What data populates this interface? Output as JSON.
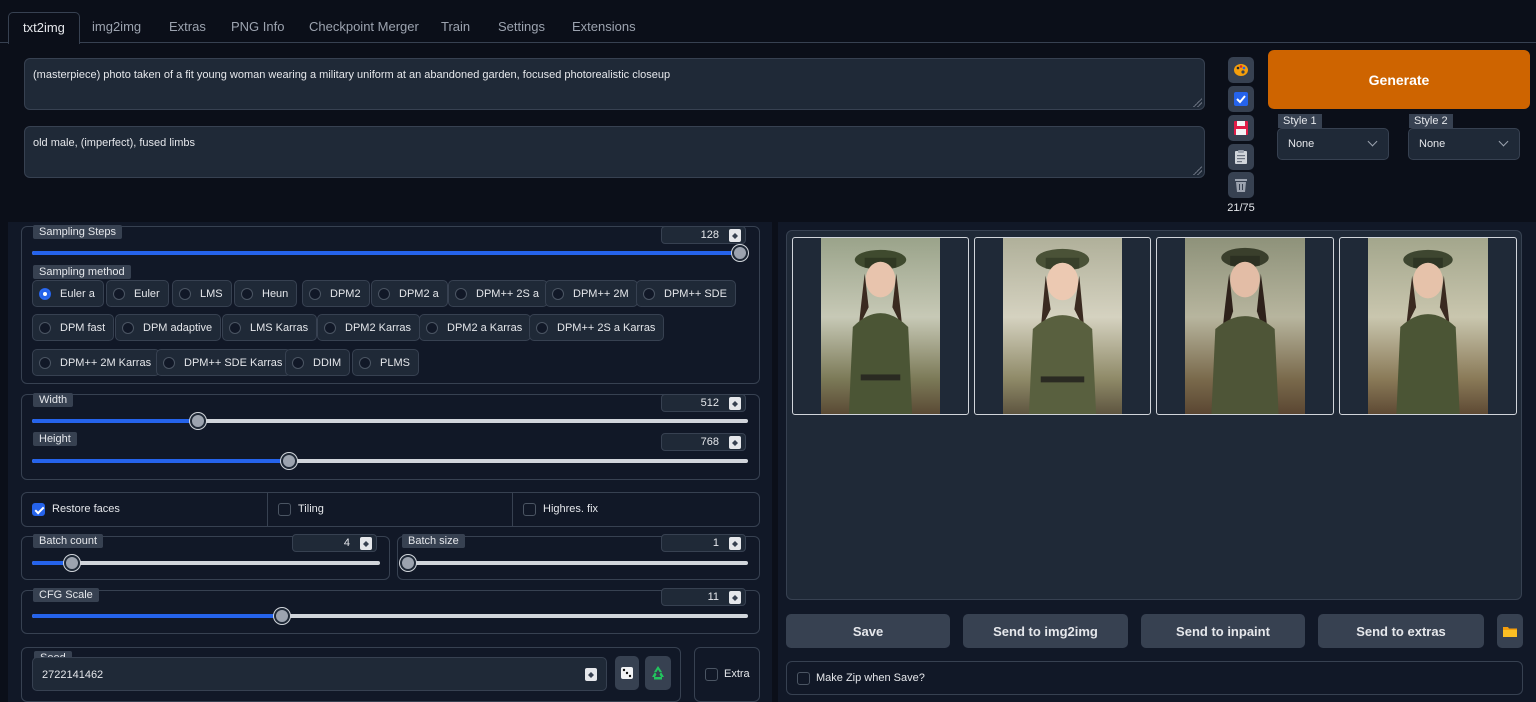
{
  "tabs": [
    "txt2img",
    "img2img",
    "Extras",
    "PNG Info",
    "Checkpoint Merger",
    "Train",
    "Settings",
    "Extensions"
  ],
  "prompt": "(masterpiece) photo taken of a fit young woman wearing a military uniform at an abandoned garden, focused photorealistic closeup",
  "negative_prompt": "old male, (imperfect), fused limbs",
  "token_counter": "21/75",
  "generate_label": "Generate",
  "styles": [
    {
      "label": "Style 1",
      "value": "None"
    },
    {
      "label": "Style 2",
      "value": "None"
    }
  ],
  "tool_icons": [
    "palette-icon",
    "checkbox-icon",
    "save-icon",
    "clipboard-icon",
    "trash-icon"
  ],
  "sampling_steps": {
    "label": "Sampling Steps",
    "value": "128",
    "fraction": 1.0
  },
  "sampling_method": {
    "label": "Sampling method",
    "selected": "Euler a",
    "options": [
      "Euler a",
      "Euler",
      "LMS",
      "Heun",
      "DPM2",
      "DPM2 a",
      "DPM++ 2S a",
      "DPM++ 2M",
      "DPM++ SDE",
      "DPM fast",
      "DPM adaptive",
      "LMS Karras",
      "DPM2 Karras",
      "DPM2 a Karras",
      "DPM++ 2S a Karras",
      "DPM++ 2M Karras",
      "DPM++ SDE Karras",
      "DDIM",
      "PLMS"
    ]
  },
  "width": {
    "label": "Width",
    "value": "512",
    "fraction": 0.23
  },
  "height": {
    "label": "Height",
    "value": "768",
    "fraction": 0.36
  },
  "restore_faces": {
    "label": "Restore faces",
    "checked": true
  },
  "tiling": {
    "label": "Tiling",
    "checked": false
  },
  "highres_fix": {
    "label": "Highres. fix",
    "checked": false
  },
  "batch_count": {
    "label": "Batch count",
    "value": "4",
    "fraction": 0.11
  },
  "batch_size": {
    "label": "Batch size",
    "value": "1",
    "fraction": 0.0
  },
  "cfg_scale": {
    "label": "CFG Scale",
    "value": "11",
    "fraction": 0.35
  },
  "seed": {
    "label": "Seed",
    "value": "2722141462"
  },
  "extra": {
    "label": "Extra",
    "checked": false
  },
  "output_buttons": [
    "Save",
    "Send to img2img",
    "Send to inpaint",
    "Send to extras"
  ],
  "make_zip": {
    "label": "Make Zip when Save?",
    "checked": false
  },
  "colors": {
    "accent": "#ce6400",
    "slider": "#2563eb",
    "bg": "#0b0f19",
    "panel": "#111827"
  }
}
